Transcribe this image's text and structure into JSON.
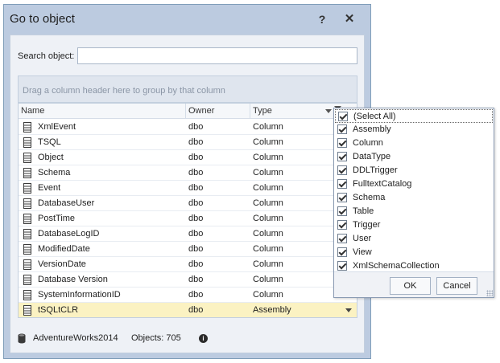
{
  "dialog": {
    "title": "Go to object",
    "help_label": "?",
    "close_label": "✕"
  },
  "search": {
    "label": "Search object:",
    "value": "",
    "placeholder": ""
  },
  "group_panel": {
    "text": "Drag a column header here to group by that column"
  },
  "grid": {
    "columns": [
      "Name",
      "Owner",
      "Type"
    ],
    "rows": [
      {
        "name": "XmlEvent",
        "owner": "dbo",
        "type": "Column"
      },
      {
        "name": "TSQL",
        "owner": "dbo",
        "type": "Column"
      },
      {
        "name": "Object",
        "owner": "dbo",
        "type": "Column"
      },
      {
        "name": "Schema",
        "owner": "dbo",
        "type": "Column"
      },
      {
        "name": "Event",
        "owner": "dbo",
        "type": "Column"
      },
      {
        "name": "DatabaseUser",
        "owner": "dbo",
        "type": "Column"
      },
      {
        "name": "PostTime",
        "owner": "dbo",
        "type": "Column"
      },
      {
        "name": "DatabaseLogID",
        "owner": "dbo",
        "type": "Column"
      },
      {
        "name": "ModifiedDate",
        "owner": "dbo",
        "type": "Column"
      },
      {
        "name": "VersionDate",
        "owner": "dbo",
        "type": "Column"
      },
      {
        "name": "Database Version",
        "owner": "dbo",
        "type": "Column"
      },
      {
        "name": "SystemInformationID",
        "owner": "dbo",
        "type": "Column"
      },
      {
        "name": "tSQLtCLR",
        "owner": "dbo",
        "type": "Assembly",
        "selected": true
      }
    ]
  },
  "status": {
    "database": "AdventureWorks2014",
    "objects": "Objects: 705",
    "info_icon": "i"
  },
  "filter_popup": {
    "items": [
      {
        "label": "(Select All)",
        "checked": true
      },
      {
        "label": "Assembly",
        "checked": true
      },
      {
        "label": "Column",
        "checked": true
      },
      {
        "label": "DataType",
        "checked": true
      },
      {
        "label": "DDLTrigger",
        "checked": true
      },
      {
        "label": "FulltextCatalog",
        "checked": true
      },
      {
        "label": "Schema",
        "checked": true
      },
      {
        "label": "Table",
        "checked": true
      },
      {
        "label": "Trigger",
        "checked": true
      },
      {
        "label": "User",
        "checked": true
      },
      {
        "label": "View",
        "checked": true
      },
      {
        "label": "XmlSchemaCollection",
        "checked": true
      }
    ],
    "ok_label": "OK",
    "cancel_label": "Cancel"
  },
  "colors": {
    "selected_row": "#fbf2c2",
    "dialog_chrome": "#bccbe0",
    "client_bg": "#eef1f6"
  }
}
